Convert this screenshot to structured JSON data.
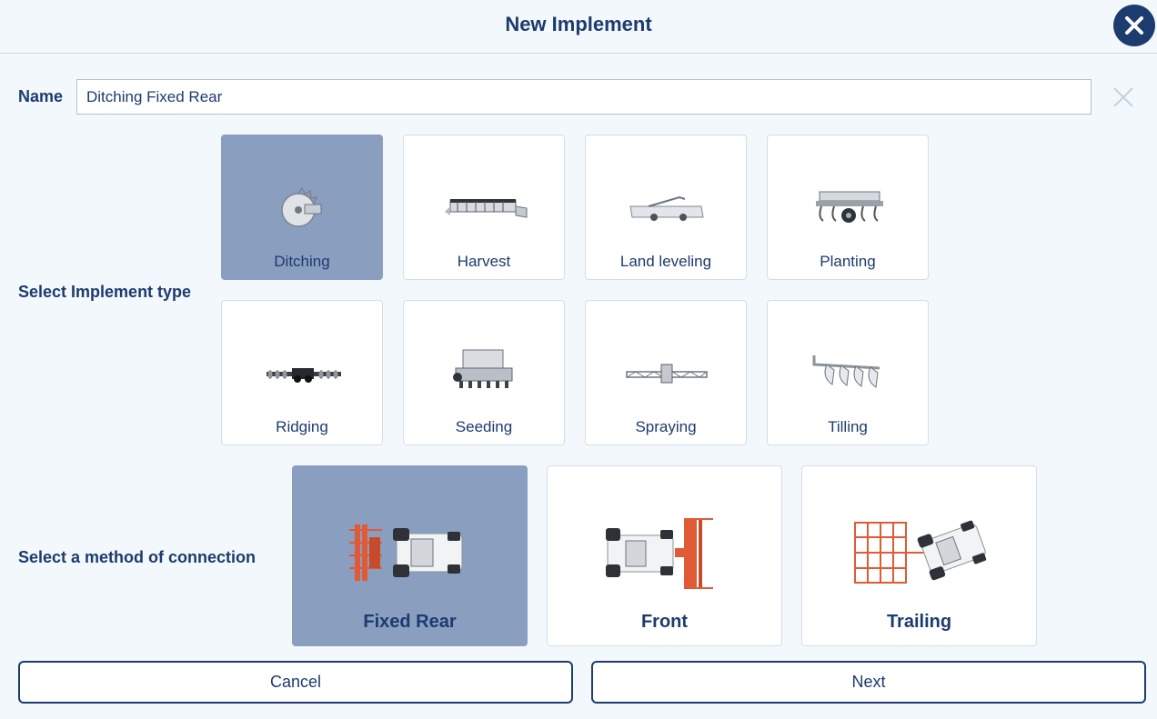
{
  "dialog": {
    "title": "New Implement"
  },
  "name": {
    "label": "Name",
    "value": "Ditching Fixed Rear"
  },
  "implement_type": {
    "label": "Select Implement type",
    "selected": "Ditching",
    "options": [
      {
        "label": "Ditching",
        "icon": "ditcher-icon"
      },
      {
        "label": "Harvest",
        "icon": "harvester-header-icon"
      },
      {
        "label": "Land leveling",
        "icon": "land-leveler-icon"
      },
      {
        "label": "Planting",
        "icon": "planter-icon"
      },
      {
        "label": "Ridging",
        "icon": "ridger-icon"
      },
      {
        "label": "Seeding",
        "icon": "seeder-icon"
      },
      {
        "label": "Spraying",
        "icon": "sprayer-icon"
      },
      {
        "label": "Tilling",
        "icon": "plough-icon"
      }
    ]
  },
  "connection": {
    "label": "Select a method of connection",
    "selected": "Fixed Rear",
    "options": [
      {
        "label": "Fixed Rear",
        "icon": "tractor-fixed-rear-icon"
      },
      {
        "label": "Front",
        "icon": "tractor-front-icon"
      },
      {
        "label": "Trailing",
        "icon": "tractor-trailing-icon"
      }
    ]
  },
  "buttons": {
    "cancel": "Cancel",
    "next": "Next"
  },
  "colors": {
    "primary": "#1c3b6e",
    "selected_card": "#8a9ebf",
    "background": "#f3f8fc",
    "implement_orange": "#e05a35"
  }
}
